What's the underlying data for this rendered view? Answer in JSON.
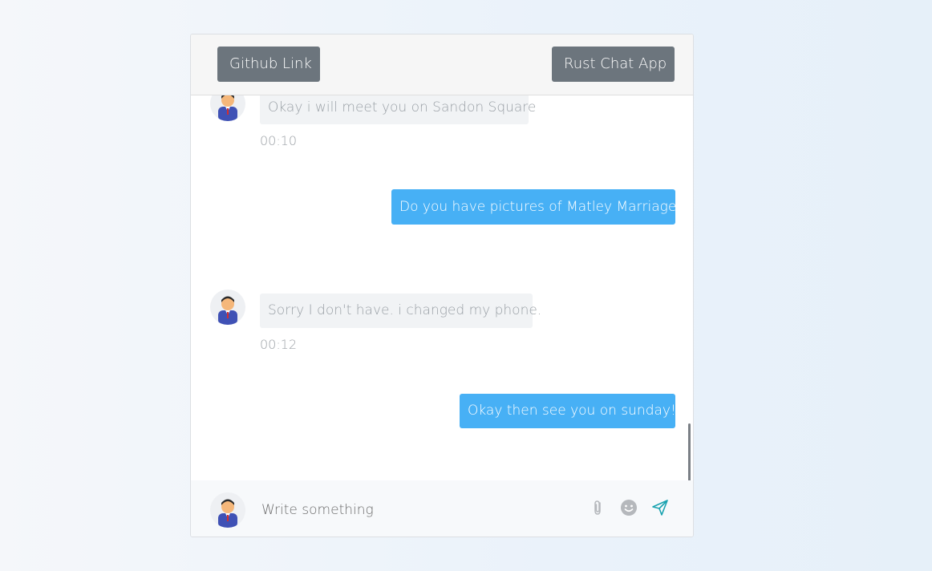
{
  "header": {
    "github_label": "Github Link",
    "app_label": "Rust Chat App"
  },
  "messages": [
    {
      "direction": "in",
      "text": "Okay i will meet you on Sandon Square",
      "time": "00:10"
    },
    {
      "direction": "out",
      "text": "Do you have pictures of Matley Marriage?"
    },
    {
      "direction": "in",
      "text": "Sorry I don't have. i changed my phone.",
      "time": "00:12"
    },
    {
      "direction": "out",
      "text": "Okay then see you on sunday!!"
    }
  ],
  "composer": {
    "placeholder": "Write something",
    "attach_icon": "paperclip-icon",
    "emoji_icon": "smiley-icon",
    "send_icon": "paper-plane-icon"
  },
  "colors": {
    "outgoing_bubble": "#47b0f5",
    "incoming_bubble": "#f1f3f5",
    "header_button": "#6c757d",
    "send_icon": "#1aa3b0"
  }
}
